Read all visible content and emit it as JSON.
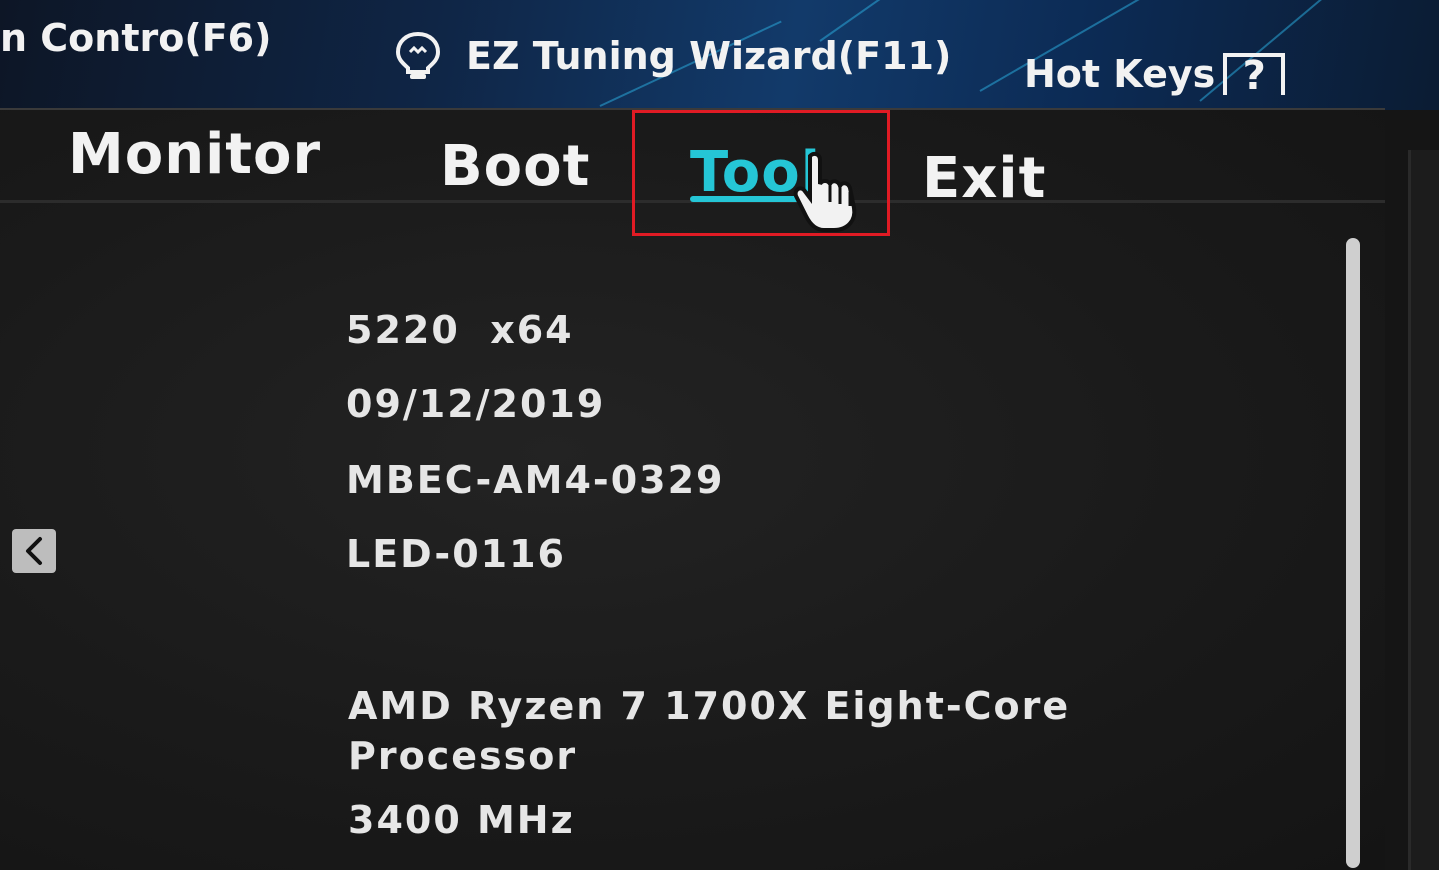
{
  "header": {
    "fan_control_label": "n Contro(F6)",
    "ez_wizard_label": "EZ Tuning Wizard(F11)",
    "hot_keys_label": "Hot Keys",
    "hot_keys_icon_text": "?"
  },
  "tabs": [
    {
      "label": "Monitor",
      "active": false
    },
    {
      "label": "Boot",
      "active": false
    },
    {
      "label": "Tool",
      "active": true
    },
    {
      "label": "Exit",
      "active": false
    }
  ],
  "info": {
    "bios_version": "5220  x64",
    "build_date": "09/12/2019",
    "ec_version": "MBEC-AM4-0329",
    "led_firmware": "LED-0116",
    "cpu_line1": "AMD Ryzen 7 1700X Eight-Core",
    "cpu_line2": "Processor",
    "cpu_speed": "3400 MHz"
  },
  "colors": {
    "accent": "#25c6d6",
    "highlight_box": "#e01b24",
    "text": "#e6e6e6",
    "background": "#1a1a1a"
  },
  "icons": {
    "bulb": "lightbulb-icon",
    "cursor": "hand-pointer-icon",
    "back": "chevron-left-icon",
    "help": "question-mark-icon"
  }
}
